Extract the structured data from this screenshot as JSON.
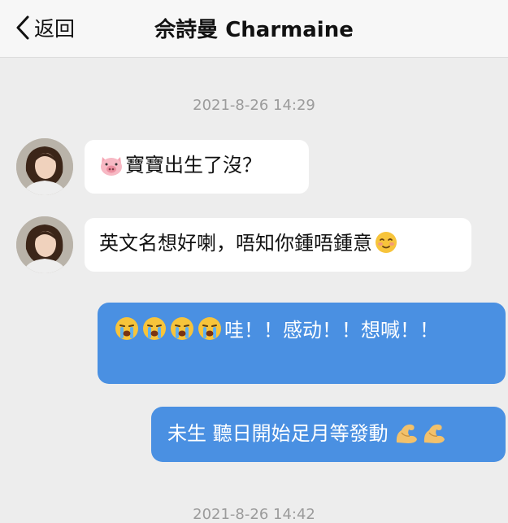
{
  "header": {
    "back_label": "返回",
    "title": "佘詩曼 Charmaine"
  },
  "messages": [
    {
      "type": "timestamp",
      "text": "2021-8-26 14:29"
    },
    {
      "type": "incoming",
      "emoji": "pig-face",
      "text": "寶寶出生了沒？"
    },
    {
      "type": "incoming",
      "text": "英文名想好喇，唔知你鍾唔鍾意",
      "trailing_emoji": "smiling-face"
    },
    {
      "type": "outgoing",
      "emojis": [
        "crying-face",
        "crying-face",
        "crying-face",
        "crying-face"
      ],
      "text": "哇！！感动！！想喊！！"
    },
    {
      "type": "outgoing",
      "text": "未生 聽日開始足月等發動",
      "trailing_emojis": [
        "flexed-biceps",
        "flexed-biceps"
      ]
    },
    {
      "type": "timestamp",
      "text": "2021-8-26 14:42"
    }
  ],
  "colors": {
    "outgoing_bubble": "#4a90e2",
    "incoming_bubble": "#ffffff",
    "background": "#ededed"
  }
}
